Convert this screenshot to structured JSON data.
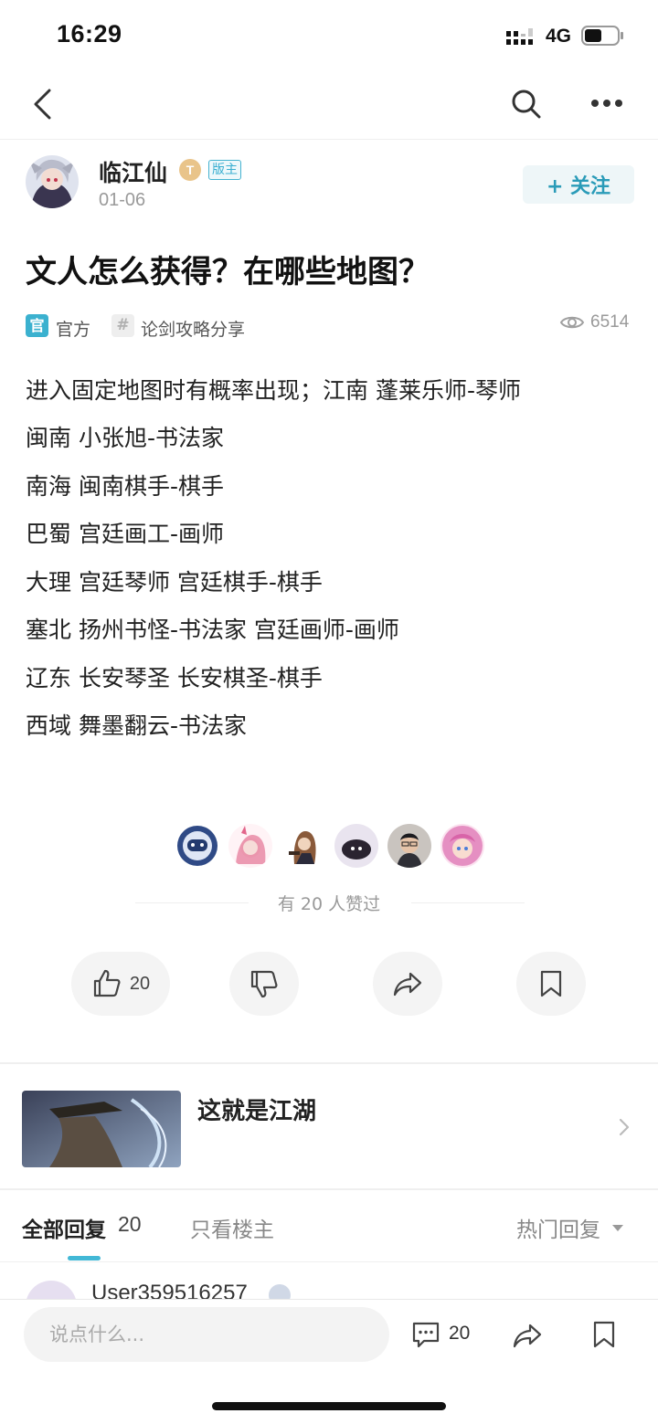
{
  "status_bar": {
    "time": "16:29",
    "network": "4G"
  },
  "author": {
    "name": "临江仙",
    "level_badge": "T",
    "role_badge": "版主",
    "date": "01-06"
  },
  "follow_label": "+ 关注",
  "post": {
    "title": "文人怎么获得？在哪些地图？",
    "tags": {
      "official_icon": "官",
      "official_label": "官方",
      "topic_icon": "#",
      "topic_label": "论剑攻略分享"
    },
    "views": "6514",
    "body": [
      "进入固定地图时有概率出现；江南 蓬莱乐师-琴师",
      "闽南 小张旭-书法家",
      "南海 闽南棋手-棋手",
      "巴蜀 宫廷画工-画师",
      "大理 宫廷琴师 宫廷棋手-棋手",
      "塞北 扬州书怪-书法家 宫廷画师-画师",
      "辽东 长安琴圣 长安棋圣-棋手",
      "西域 舞墨翻云-书法家"
    ]
  },
  "likes_summary": "有 20 人赞过",
  "actions": {
    "like_count": "20"
  },
  "circle": {
    "name": "这就是江湖"
  },
  "reply_tabs": {
    "all_label": "全部回复",
    "all_count": "20",
    "op_only_label": "只看楼主",
    "sort_label": "热门回复"
  },
  "reply_peek": {
    "user": "User359516257"
  },
  "bottom": {
    "input_placeholder": "说点什么...",
    "comment_count": "20"
  },
  "icons": [
    "back-icon",
    "search-icon",
    "more-icon",
    "eye-icon",
    "thumbs-up-icon",
    "thumbs-down-icon",
    "share-icon",
    "bookmark-icon",
    "chevron-right-icon",
    "caret-down-icon",
    "comment-icon"
  ],
  "colors": {
    "accent": "#42b8d6",
    "text": "#222222",
    "muted": "#999999"
  }
}
